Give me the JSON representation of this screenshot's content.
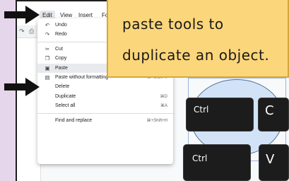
{
  "menubar": {
    "items": [
      "Edit",
      "View",
      "Insert",
      "Fo"
    ]
  },
  "toolbar": {
    "icons": [
      "redo-icon",
      "print-icon"
    ]
  },
  "edit_menu": {
    "items": [
      {
        "icon": "undo-icon",
        "label": "Undo",
        "shortcut": ""
      },
      {
        "icon": "redo-icon",
        "label": "Redo",
        "shortcut": ""
      },
      {
        "icon": "cut-icon",
        "label": "Cut",
        "shortcut": ""
      },
      {
        "icon": "copy-icon",
        "label": "Copy",
        "shortcut": ""
      },
      {
        "icon": "paste-icon",
        "label": "Paste",
        "shortcut": "⌘V"
      },
      {
        "icon": "paste-plain-icon",
        "label": "Paste without formatting",
        "shortcut": "⌘+Shift+V"
      },
      {
        "icon": "",
        "label": "Delete",
        "shortcut": ""
      },
      {
        "icon": "",
        "label": "Duplicate",
        "shortcut": "⌘D"
      },
      {
        "icon": "",
        "label": "Select all",
        "shortcut": "⌘A"
      },
      {
        "icon": "",
        "label": "Find and replace",
        "shortcut": "⌘+Shift+H"
      }
    ]
  },
  "keys": {
    "ctrl_top": "Ctrl",
    "c": "C",
    "ctrl_bottom": "Ctrl",
    "v": "V"
  },
  "note": {
    "line1": "paste tools to",
    "line2": "duplicate an object."
  },
  "colors": {
    "background": "#e6d6ec",
    "note_fill": "#fcd67a",
    "key_fill": "#1c1c1c",
    "shape_fill": "#d2e3f7"
  }
}
